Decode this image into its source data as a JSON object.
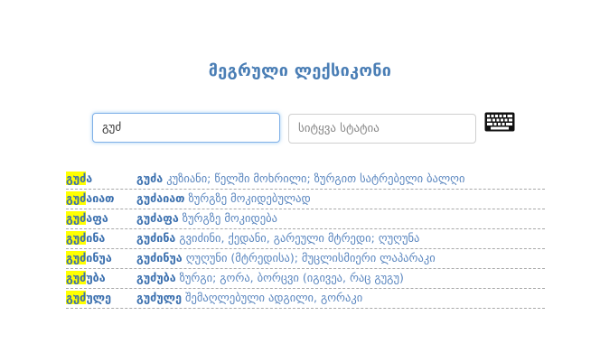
{
  "page": {
    "title": "მეგრული ლექსიკონი"
  },
  "search": {
    "value": "გუძ",
    "article_placeholder": "სიტყვა სტატია"
  },
  "icons": {
    "keyboard": "keyboard-icon"
  },
  "colors": {
    "accent": "#4a7eb5",
    "highlight": "#ffff00",
    "text": "#5a86bf"
  },
  "results": [
    {
      "match": "გუძ",
      "rest": "ა",
      "head": "გუძა",
      "definition": "კუზიანი; წელში მოხრილი; ზურგით სატრებელი ბალღი"
    },
    {
      "match": "გუძ",
      "rest": "აიათ",
      "head": "გუძაიათ",
      "definition": "ზურგზე მოკიდებულად"
    },
    {
      "match": "გუძ",
      "rest": "აფა",
      "head": "გუძაფა",
      "definition": "ზურგზე მოკიდება"
    },
    {
      "match": "გუძ",
      "rest": "ინა",
      "head": "გუძინა",
      "definition": "გვიძინი, ქედანი, გარეული მტრედი; ღუღუნა"
    },
    {
      "match": "გუძ",
      "rest": "ინუა",
      "head": "გუძინუა",
      "definition": "ღუღუნი (მტრედისა); მუცლისმიერი ლაპარაკი"
    },
    {
      "match": "გუძ",
      "rest": "უბა",
      "head": "გუძუბა",
      "definition": "ზურგი; გორა, ბორცვი (იგივეა, რაც გუგუ)"
    },
    {
      "match": "გუძ",
      "rest": "ულე",
      "head": "გუძულე",
      "definition": "შემაღლებული ადგილი, გორაკი"
    }
  ]
}
